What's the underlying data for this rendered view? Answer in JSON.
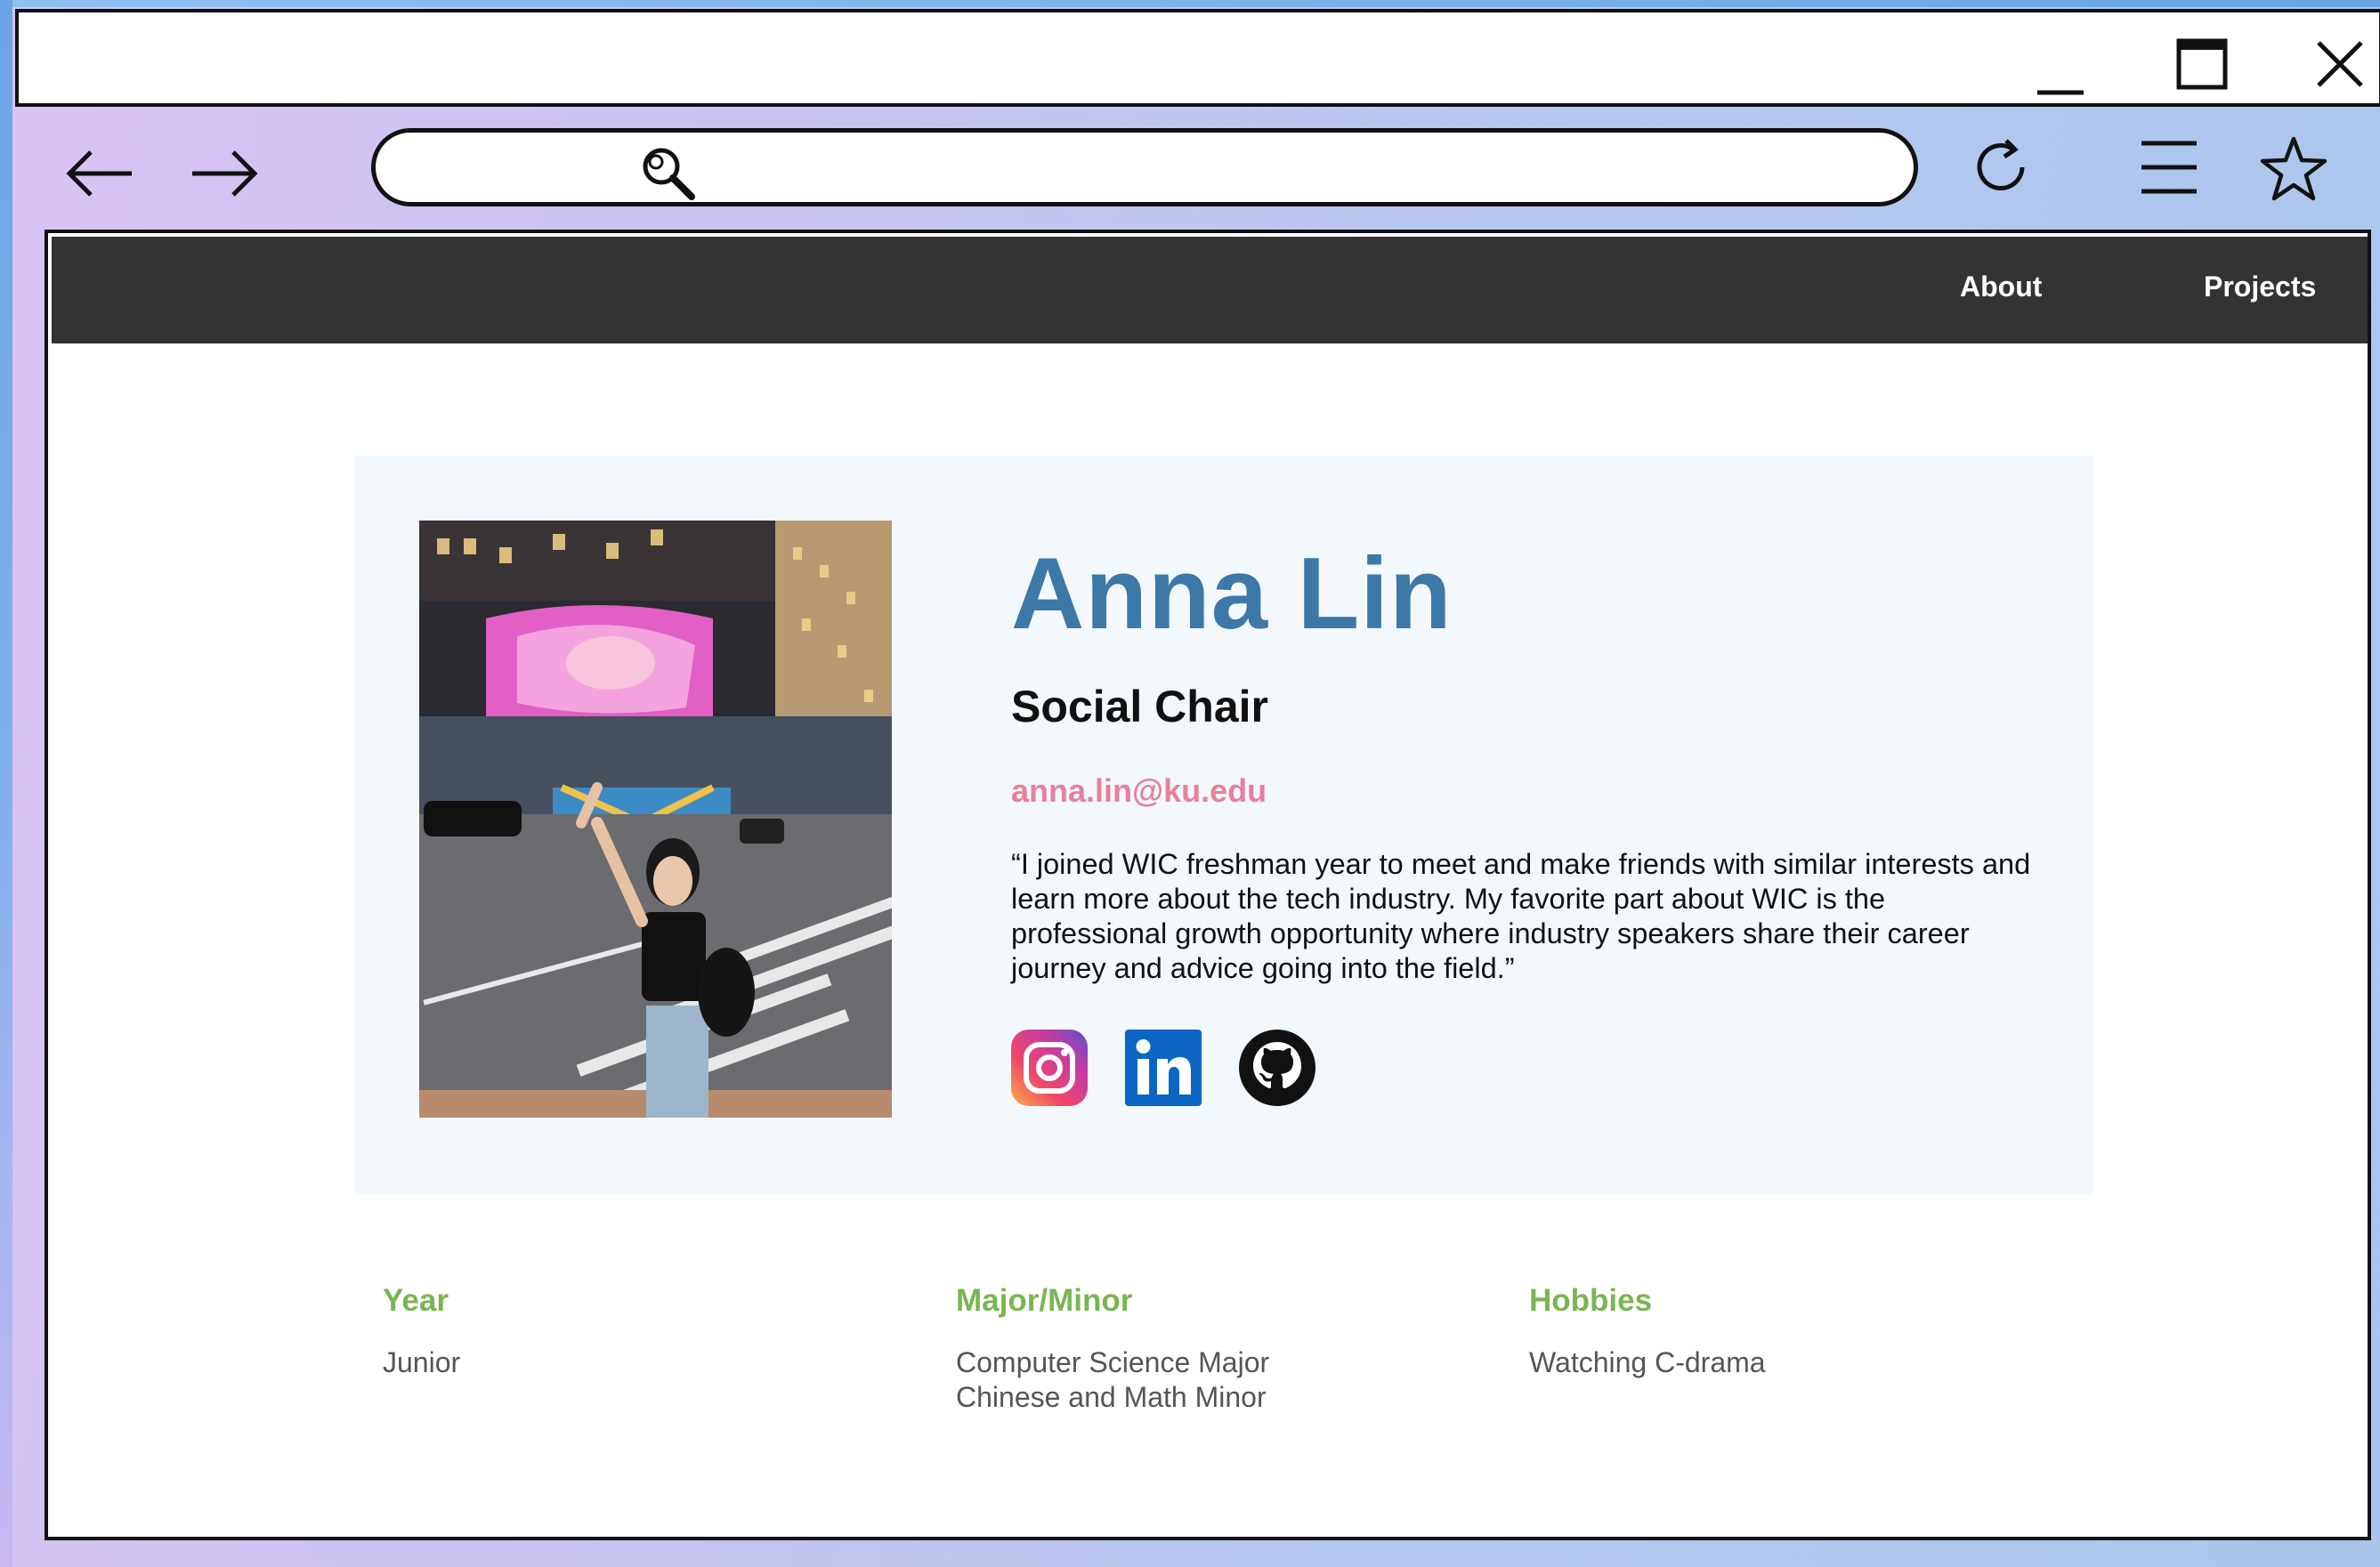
{
  "browser": {
    "window_controls": {
      "minimize_icon": "minimize-icon",
      "maximize_icon": "maximize-icon",
      "close_icon": "close-icon"
    },
    "address_bar": {
      "value": "",
      "placeholder": ""
    },
    "toolbar_icons": [
      "back-arrow-icon",
      "forward-arrow-icon",
      "search-icon",
      "reload-icon",
      "menu-icon",
      "star-icon"
    ]
  },
  "site_nav": {
    "links": [
      {
        "label": "About"
      },
      {
        "label": "Projects"
      }
    ]
  },
  "profile": {
    "name": "Anna Lin",
    "role": "Social Chair",
    "email": "anna.lin@ku.edu",
    "quote": "“I joined WIC freshman year to meet and make friends with similar interests and learn more about the tech industry. My favorite part about WIC is the professional growth opportunity where industry speakers share their career journey and advice going into the field.”",
    "socials": [
      "instagram-icon",
      "linkedin-icon",
      "github-icon"
    ]
  },
  "details": {
    "year": {
      "label": "Year",
      "value": "Junior"
    },
    "major_minor": {
      "label": "Major/Minor",
      "line1": "Computer Science Major",
      "line2": "Chinese and Math Minor"
    },
    "hobbies": {
      "label": "Hobbies",
      "value": "Watching C-drama"
    }
  },
  "colors": {
    "name": "#3c78a8",
    "email": "#e8809a",
    "detail_label": "#7ab552",
    "nav_bg": "#333333",
    "card_bg": "#f3f8fc"
  }
}
